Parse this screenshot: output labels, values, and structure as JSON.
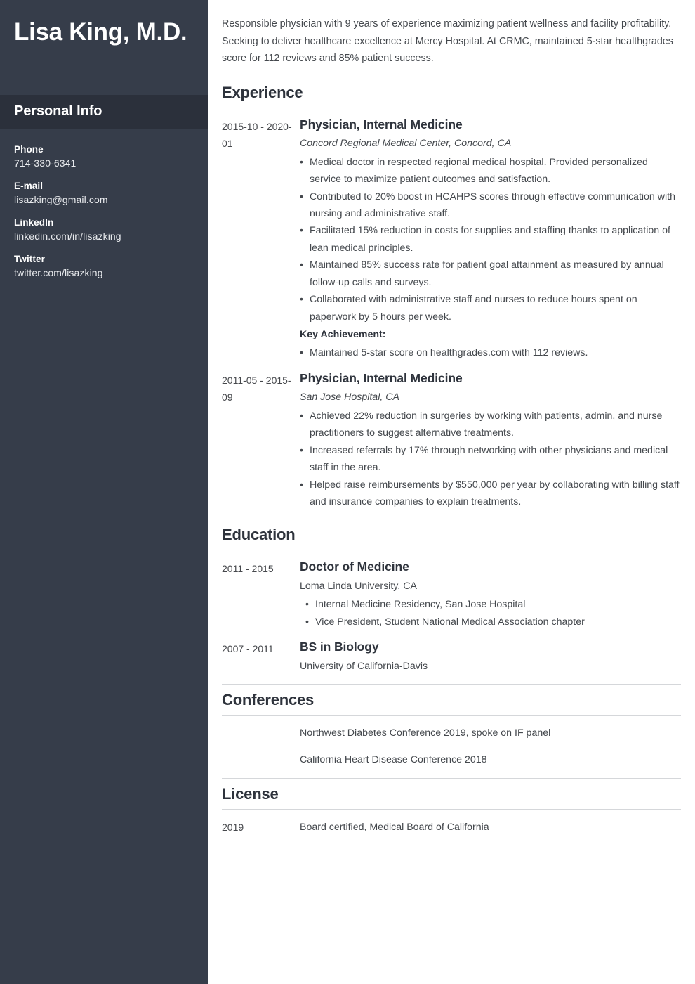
{
  "theme": {
    "sidebar_bg": "#363d4a",
    "sidebar_bar_bg": "#2b303b",
    "heading_color": "#2e333c",
    "text_color": "#44484d",
    "rule_color": "#d5d7da"
  },
  "sidebar": {
    "name": "Lisa King, M.D.",
    "personal_info_title": "Personal Info",
    "contacts": [
      {
        "label": "Phone",
        "value": "714-330-6341"
      },
      {
        "label": "E-mail",
        "value": "lisazking@gmail.com"
      },
      {
        "label": "LinkedIn",
        "value": "linkedin.com/in/lisazking"
      },
      {
        "label": "Twitter",
        "value": "twitter.com/lisazking"
      }
    ]
  },
  "main": {
    "summary": "Responsible physician with 9 years of experience maximizing patient wellness and facility profitability. Seeking to deliver healthcare excellence at Mercy Hospital. At CRMC, maintained 5-star healthgrades score for 112 reviews and 85% patient success.",
    "experience": {
      "title": "Experience",
      "entries": [
        {
          "date": "2015-10 - 2020-01",
          "title": "Physician, Internal Medicine",
          "employer": "Concord Regional Medical Center, Concord, CA",
          "bullets": [
            "Medical doctor in respected regional medical hospital. Provided personalized service to maximize patient outcomes and satisfaction.",
            "Contributed to 20% boost in HCAHPS scores through effective communication with nursing and administrative staff.",
            "Facilitated 15% reduction in costs for supplies and staffing thanks to application of lean medical principles.",
            "Maintained 85% success rate for patient goal attainment as measured by annual follow-up calls and surveys.",
            "Collaborated with administrative staff and nurses to reduce hours spent on paperwork by 5 hours per week."
          ],
          "key_achievement_label": "Key Achievement:",
          "key_achievements": [
            "Maintained 5-star score on healthgrades.com with 112 reviews."
          ]
        },
        {
          "date": "2011-05 - 2015-09",
          "title": "Physician, Internal Medicine",
          "employer": "San Jose Hospital, CA",
          "bullets": [
            "Achieved 22% reduction in surgeries by working with patients, admin, and nurse practitioners to suggest alternative treatments.",
            "Increased referrals by 17% through networking with other physicians and medical staff in the area.",
            "Helped raise reimbursements by $550,000 per year by collaborating with billing staff and insurance companies to explain treatments."
          ]
        }
      ]
    },
    "education": {
      "title": "Education",
      "entries": [
        {
          "date": "2011 - 2015",
          "title": "Doctor of Medicine",
          "school": "Loma Linda University, CA",
          "bullets": [
            "Internal Medicine Residency, San Jose Hospital",
            "Vice President, Student National Medical Association chapter"
          ]
        },
        {
          "date": "2007 - 2011",
          "title": "BS in Biology",
          "school": "University of California-Davis",
          "bullets": []
        }
      ]
    },
    "conferences": {
      "title": "Conferences",
      "entries": [
        {
          "date": "",
          "text": "Northwest Diabetes Conference 2019, spoke on IF panel"
        },
        {
          "date": "",
          "text": "California Heart Disease Conference 2018"
        }
      ]
    },
    "license": {
      "title": "License",
      "entries": [
        {
          "date": "2019",
          "text": "Board certified, Medical Board of California"
        }
      ]
    }
  }
}
